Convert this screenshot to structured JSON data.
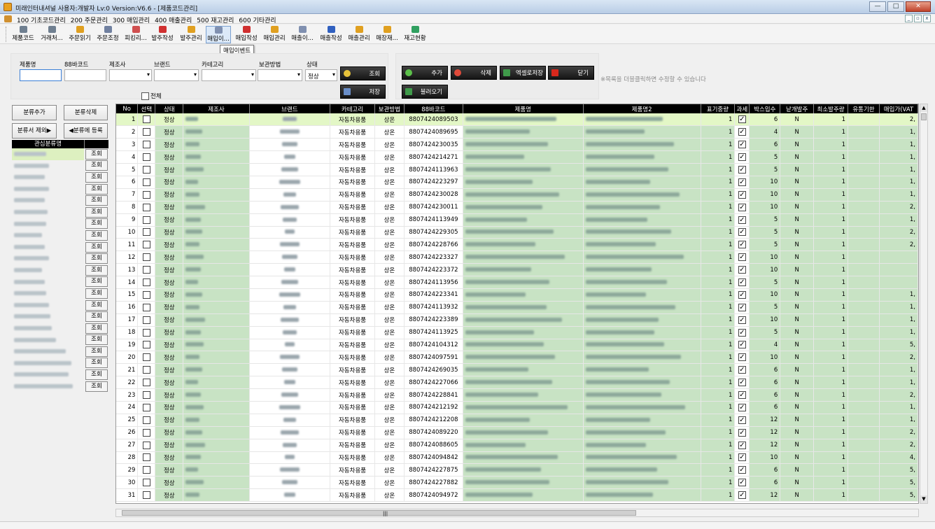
{
  "window": {
    "title": "미래인터내셔널 사용자:개발자 Lv:0   Version:V6.6 - [제품코드관리]",
    "min": "—",
    "max": "□",
    "close": "✕"
  },
  "menu": [
    "100 기초코드관리",
    "200 주문관리",
    "300 매입관리",
    "400 매출관리",
    "500 재고관리",
    "600 기타관리"
  ],
  "toolbar": [
    "제품코드",
    "거래처...",
    "주문읽기",
    "주문조정",
    "피킹리...",
    "발주작성",
    "발주관리",
    "매입이...",
    "매입작성",
    "매입관리",
    "매출이...",
    "매출작성",
    "매출관리",
    "매장재...",
    "재고현황"
  ],
  "tooltip": "매입이벤트",
  "search": {
    "labels": {
      "product": "제품명",
      "barcode": "88바코드",
      "maker": "제조사",
      "brand": "브랜드",
      "category": "카테고리",
      "storage": "보관방법",
      "status": "상태"
    },
    "status_value": "정상",
    "query_btn": "조회",
    "save_btn": "저장"
  },
  "actions": {
    "add": "추가",
    "delete": "삭제",
    "excel": "엑셀로저장",
    "close": "닫기",
    "load": "불러오기"
  },
  "hint": "※목록을 더블클릭하면 수정할 수 있습니다",
  "all_label": "전체",
  "side": {
    "add": "분류추가",
    "del": "분류삭제",
    "exclude": "분류서 제외▶",
    "register": "◀분류에 등록",
    "header": "관심분류명",
    "query": "조회"
  },
  "columns": [
    "No",
    "선택",
    "상태",
    "제조사",
    "브랜드",
    "카테고리",
    "보관방법",
    "88바코드",
    "제품명",
    "제품명2",
    "표기중량",
    "과세",
    "박스입수",
    "낱개발주",
    "최소발주량",
    "유통기한",
    "매입가(VAT"
  ],
  "rows": [
    {
      "no": "1",
      "barcode": "8807424089503",
      "box": "6",
      "price": "2,"
    },
    {
      "no": "2",
      "barcode": "8807424089695",
      "box": "4",
      "price": "1,"
    },
    {
      "no": "3",
      "barcode": "8807424230035",
      "box": "6",
      "price": "1,"
    },
    {
      "no": "4",
      "barcode": "8807424214271",
      "box": "5",
      "price": "1,"
    },
    {
      "no": "5",
      "barcode": "8807424113963",
      "box": "5",
      "price": "1,"
    },
    {
      "no": "6",
      "barcode": "8807424223297",
      "box": "10",
      "price": "1,"
    },
    {
      "no": "7",
      "barcode": "8807424230028",
      "box": "10",
      "price": "1,"
    },
    {
      "no": "8",
      "barcode": "8807424230011",
      "box": "10",
      "price": "2,"
    },
    {
      "no": "9",
      "barcode": "8807424113949",
      "box": "5",
      "price": "1,"
    },
    {
      "no": "10",
      "barcode": "8807424229305",
      "box": "5",
      "price": "2,"
    },
    {
      "no": "11",
      "barcode": "8807424228766",
      "box": "5",
      "price": "2,"
    },
    {
      "no": "12",
      "barcode": "8807424223327",
      "box": "10",
      "price": ""
    },
    {
      "no": "13",
      "barcode": "8807424223372",
      "box": "10",
      "price": ""
    },
    {
      "no": "14",
      "barcode": "8807424113956",
      "box": "5",
      "price": ""
    },
    {
      "no": "15",
      "barcode": "8807424223341",
      "box": "10",
      "price": "1,"
    },
    {
      "no": "16",
      "barcode": "8807424113932",
      "box": "5",
      "price": "1,"
    },
    {
      "no": "17",
      "barcode": "8807424223389",
      "box": "10",
      "price": "1,"
    },
    {
      "no": "18",
      "barcode": "8807424113925",
      "box": "5",
      "price": "1,"
    },
    {
      "no": "19",
      "barcode": "8807424104312",
      "box": "4",
      "price": "5,"
    },
    {
      "no": "20",
      "barcode": "8807424097591",
      "box": "10",
      "price": "2,"
    },
    {
      "no": "21",
      "barcode": "8807424269035",
      "box": "6",
      "price": "1,"
    },
    {
      "no": "22",
      "barcode": "8807424227066",
      "box": "6",
      "price": "1,"
    },
    {
      "no": "23",
      "barcode": "8807424228841",
      "box": "6",
      "price": "2,"
    },
    {
      "no": "24",
      "barcode": "8807424212192",
      "box": "6",
      "price": "1,"
    },
    {
      "no": "25",
      "barcode": "8807424212208",
      "box": "12",
      "price": "1,"
    },
    {
      "no": "26",
      "barcode": "8807424089220",
      "box": "12",
      "price": "2,"
    },
    {
      "no": "27",
      "barcode": "8807424088605",
      "box": "12",
      "price": "2,"
    },
    {
      "no": "28",
      "barcode": "8807424094842",
      "box": "10",
      "price": "4,"
    },
    {
      "no": "29",
      "barcode": "8807424227875",
      "box": "6",
      "price": "5,"
    },
    {
      "no": "30",
      "barcode": "8807424227882",
      "box": "6",
      "price": "5,"
    },
    {
      "no": "31",
      "barcode": "8807424094972",
      "box": "12",
      "price": "5,"
    }
  ],
  "row_defaults": {
    "status": "정상",
    "category": "자동차용품",
    "storage": "상온",
    "weight": "1",
    "tax": "✓",
    "single": "N",
    "min": "1"
  },
  "scroll": {
    "up": "▲",
    "down": "▼",
    "grip": "|||"
  },
  "colors": {
    "header_bg": "#000000",
    "green_cell": "#c8e3c4",
    "selected_row": "#e3f7c6"
  }
}
